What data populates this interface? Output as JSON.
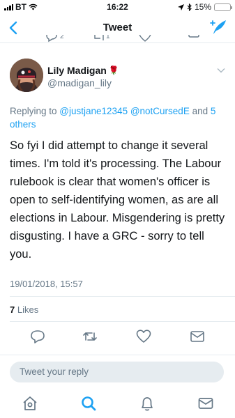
{
  "status_bar": {
    "carrier": "BT",
    "time": "16:22",
    "battery": "15%",
    "battery_level": 0.15
  },
  "nav": {
    "title": "Tweet"
  },
  "previous_tweet": {
    "reply_count": "2",
    "retweet_count": "1"
  },
  "tweet": {
    "author_name": "Lily Madigan",
    "author_emoji": "🌹",
    "author_handle": "@madigan_lily",
    "reply_prefix": "Replying to ",
    "reply_users": "@justjane12345 @notCursedE",
    "reply_suffix_and": " and ",
    "reply_others": "5 others",
    "text": "So fyi I did attempt to change it several times. I'm told it's processing. The Labour rulebook is clear that women's officer is open to self-identifying women, as are all elections in Labour. Misgendering is pretty disgusting. I have a GRC - sorry to tell you.",
    "timestamp": "19/01/2018, 15:57",
    "like_count": "7",
    "like_label": "Likes"
  },
  "composer": {
    "placeholder": "Tweet your reply"
  },
  "colors": {
    "accent": "#1da1f2",
    "icon_gray": "#657786",
    "reply_box_bg": "#e6ecf0"
  },
  "icons": [
    "back-icon",
    "compose-icon",
    "caret-down-icon",
    "reply-icon",
    "retweet-icon",
    "like-icon",
    "dm-icon",
    "home-icon",
    "search-icon",
    "notifications-icon",
    "messages-icon"
  ]
}
